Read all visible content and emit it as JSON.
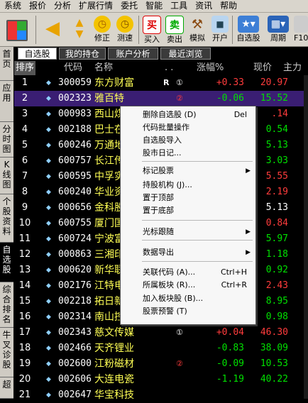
{
  "menubar": {
    "items": [
      "系统",
      "报价",
      "分析",
      "扩展行情",
      "委托",
      "智能",
      "工具",
      "资讯",
      "帮助"
    ]
  },
  "toolbar": {
    "buttons": [
      {
        "label": "",
        "icon": "grid-icon"
      },
      {
        "label": "",
        "icon": "arrow-left-icon"
      },
      {
        "label": "",
        "icon": "arrow-updown-icon"
      },
      {
        "label": "修正",
        "icon": "modify-icon"
      },
      {
        "label": "测速",
        "icon": "clock-icon"
      },
      {
        "label": "买入",
        "icon": "buy-icon",
        "glyph": "买"
      },
      {
        "label": "卖出",
        "icon": "sell-icon",
        "glyph": "卖"
      },
      {
        "label": "模拟",
        "icon": "hammer-icon"
      },
      {
        "label": "开户",
        "icon": "account-icon"
      },
      {
        "label": "自选股",
        "icon": "favorites-icon"
      },
      {
        "label": "周期",
        "icon": "period-icon"
      },
      {
        "label": "F10",
        "icon": "f10-icon"
      }
    ]
  },
  "sidebar": {
    "items": [
      "首页",
      "应用",
      "分时图",
      "K线图",
      "个股资料",
      "自选股",
      "综合排名",
      "牛叉诊股",
      "超"
    ]
  },
  "tabs": [
    "自选股",
    "我的持仓",
    "账户分析",
    "最近浏览"
  ],
  "table": {
    "headers": {
      "index": "排序",
      "code": "代码",
      "name": "名称",
      "dots": ". .",
      "change": "涨幅%",
      "price": "现价",
      "main": "主力"
    },
    "rows": [
      {
        "n": "1",
        "code": "300059",
        "name": "东方财富",
        "flag": "R",
        "circ": "①",
        "chg": "+0.33",
        "price": "20.97",
        "dir": "up"
      },
      {
        "n": "2",
        "code": "002323",
        "name": "雅百特",
        "flag": "",
        "circ": "②",
        "chg": "-0.06",
        "price": "15.52",
        "dir": "dn"
      },
      {
        "n": "3",
        "code": "000983",
        "name": "西山煤电",
        "flag": "",
        "circ": "",
        "chg": "",
        "price": ".14",
        "dir": "up"
      },
      {
        "n": "4",
        "code": "002188",
        "name": "巴士在线",
        "flag": "",
        "circ": "",
        "chg": "",
        "price": "0.54",
        "dir": "dn"
      },
      {
        "n": "5",
        "code": "600246",
        "name": "万通地产",
        "flag": "",
        "circ": "",
        "chg": "",
        "price": "5.13",
        "dir": "dn"
      },
      {
        "n": "6",
        "code": "600757",
        "name": "长江传媒",
        "flag": "",
        "circ": "",
        "chg": "",
        "price": "3.03",
        "dir": "dn"
      },
      {
        "n": "7",
        "code": "600595",
        "name": "中孚实业",
        "flag": "",
        "circ": "",
        "chg": "",
        "price": "5.55",
        "dir": "up"
      },
      {
        "n": "8",
        "code": "600240",
        "name": "华业资本",
        "flag": "",
        "circ": "",
        "chg": "",
        "price": "2.19",
        "dir": "up"
      },
      {
        "n": "9",
        "code": "000656",
        "name": "金科股份",
        "flag": "",
        "circ": "",
        "chg": "",
        "price": "5.13",
        "dir": "wh"
      },
      {
        "n": "10",
        "code": "600755",
        "name": "厦门国贸",
        "flag": "",
        "circ": "",
        "chg": "",
        "price": "0.84",
        "dir": "up"
      },
      {
        "n": "11",
        "code": "600724",
        "name": "宁波富达",
        "flag": "",
        "circ": "",
        "chg": "",
        "price": "5.97",
        "dir": "dn"
      },
      {
        "n": "12",
        "code": "000863",
        "name": "三湘印象",
        "flag": "",
        "circ": "",
        "chg": "",
        "price": "1.18",
        "dir": "dn"
      },
      {
        "n": "13",
        "code": "000620",
        "name": "新华联",
        "flag": "",
        "circ": "",
        "chg": "",
        "price": "0.92",
        "dir": "dn"
      },
      {
        "n": "14",
        "code": "002176",
        "name": "江特电机",
        "flag": "",
        "circ": "",
        "chg": "",
        "price": "2.43",
        "dir": "up"
      },
      {
        "n": "15",
        "code": "002218",
        "name": "拓日新能",
        "flag": "",
        "circ": "",
        "chg": "",
        "price": "8.95",
        "dir": "dn"
      },
      {
        "n": "16",
        "code": "002314",
        "name": "南山控股",
        "flag": "",
        "circ": "",
        "chg": "",
        "price": "0.98",
        "dir": "dn"
      },
      {
        "n": "17",
        "code": "002343",
        "name": "慈文传媒",
        "flag": "",
        "circ": "①",
        "chg": "+0.04",
        "price": "46.30",
        "dir": "up"
      },
      {
        "n": "18",
        "code": "002466",
        "name": "天齐锂业",
        "flag": "",
        "circ": "",
        "chg": "-0.83",
        "price": "38.09",
        "dir": "dn"
      },
      {
        "n": "19",
        "code": "002600",
        "name": "江粉磁材",
        "flag": "",
        "circ": "②",
        "chg": "-0.09",
        "price": "10.53",
        "dir": "dn"
      },
      {
        "n": "20",
        "code": "002606",
        "name": "大连电瓷",
        "flag": "",
        "circ": "",
        "chg": "-1.19",
        "price": "40.22",
        "dir": "dn"
      },
      {
        "n": "21",
        "code": "002647",
        "name": "华宝科技",
        "flag": "",
        "circ": "",
        "chg": "",
        "price": "",
        "dir": "wh"
      }
    ]
  },
  "context_menu": {
    "items": [
      {
        "label": "删除自选股 (D)",
        "shortcut": "Del",
        "submenu": false
      },
      {
        "label": "代码批量操作",
        "shortcut": "",
        "submenu": false
      },
      {
        "label": "自选股导入",
        "shortcut": "",
        "submenu": false
      },
      {
        "label": "股市日记...",
        "shortcut": "",
        "submenu": false
      },
      {
        "label": "标记股票",
        "shortcut": "",
        "submenu": true
      },
      {
        "label": "持股机构 (J)...",
        "shortcut": "",
        "submenu": false
      },
      {
        "label": "置于顶部",
        "shortcut": "",
        "submenu": false
      },
      {
        "label": "置于底部",
        "shortcut": "",
        "submenu": false
      },
      {
        "label": "光标跟随",
        "shortcut": "",
        "submenu": true
      },
      {
        "label": "数据导出",
        "shortcut": "",
        "submenu": true
      },
      {
        "label": "关联代码 (A)...",
        "shortcut": "Ctrl+H",
        "submenu": false
      },
      {
        "label": "所属板块 (R)...",
        "shortcut": "Ctrl+R",
        "submenu": false
      },
      {
        "label": "加入板块股 (B)...",
        "shortcut": "",
        "submenu": false
      },
      {
        "label": "股票预警 (T)",
        "shortcut": "",
        "submenu": false
      }
    ]
  },
  "colors": {
    "up": "#ff3c3c",
    "down": "#00e000",
    "name": "#ffff55",
    "selected_row": "#3a1e73"
  }
}
